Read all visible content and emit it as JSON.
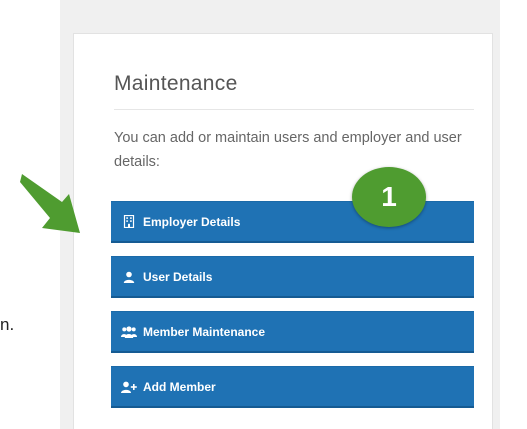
{
  "maintenance": {
    "title": "Maintenance",
    "description": "You can add or maintain users and employer and user details:",
    "buttons": [
      {
        "label": "Employer Details",
        "icon": "building-icon"
      },
      {
        "label": "User Details",
        "icon": "user-icon"
      },
      {
        "label": "Member Maintenance",
        "icon": "users-icon"
      },
      {
        "label": "Add Member",
        "icon": "user-plus-icon"
      }
    ]
  },
  "callout": {
    "step_number": "1",
    "badge_color": "#4f9c30",
    "arrow_color": "#4f9c30",
    "stray_text": "n."
  },
  "colors": {
    "button_blue": "#1f72b4",
    "title_gray": "#555555"
  }
}
